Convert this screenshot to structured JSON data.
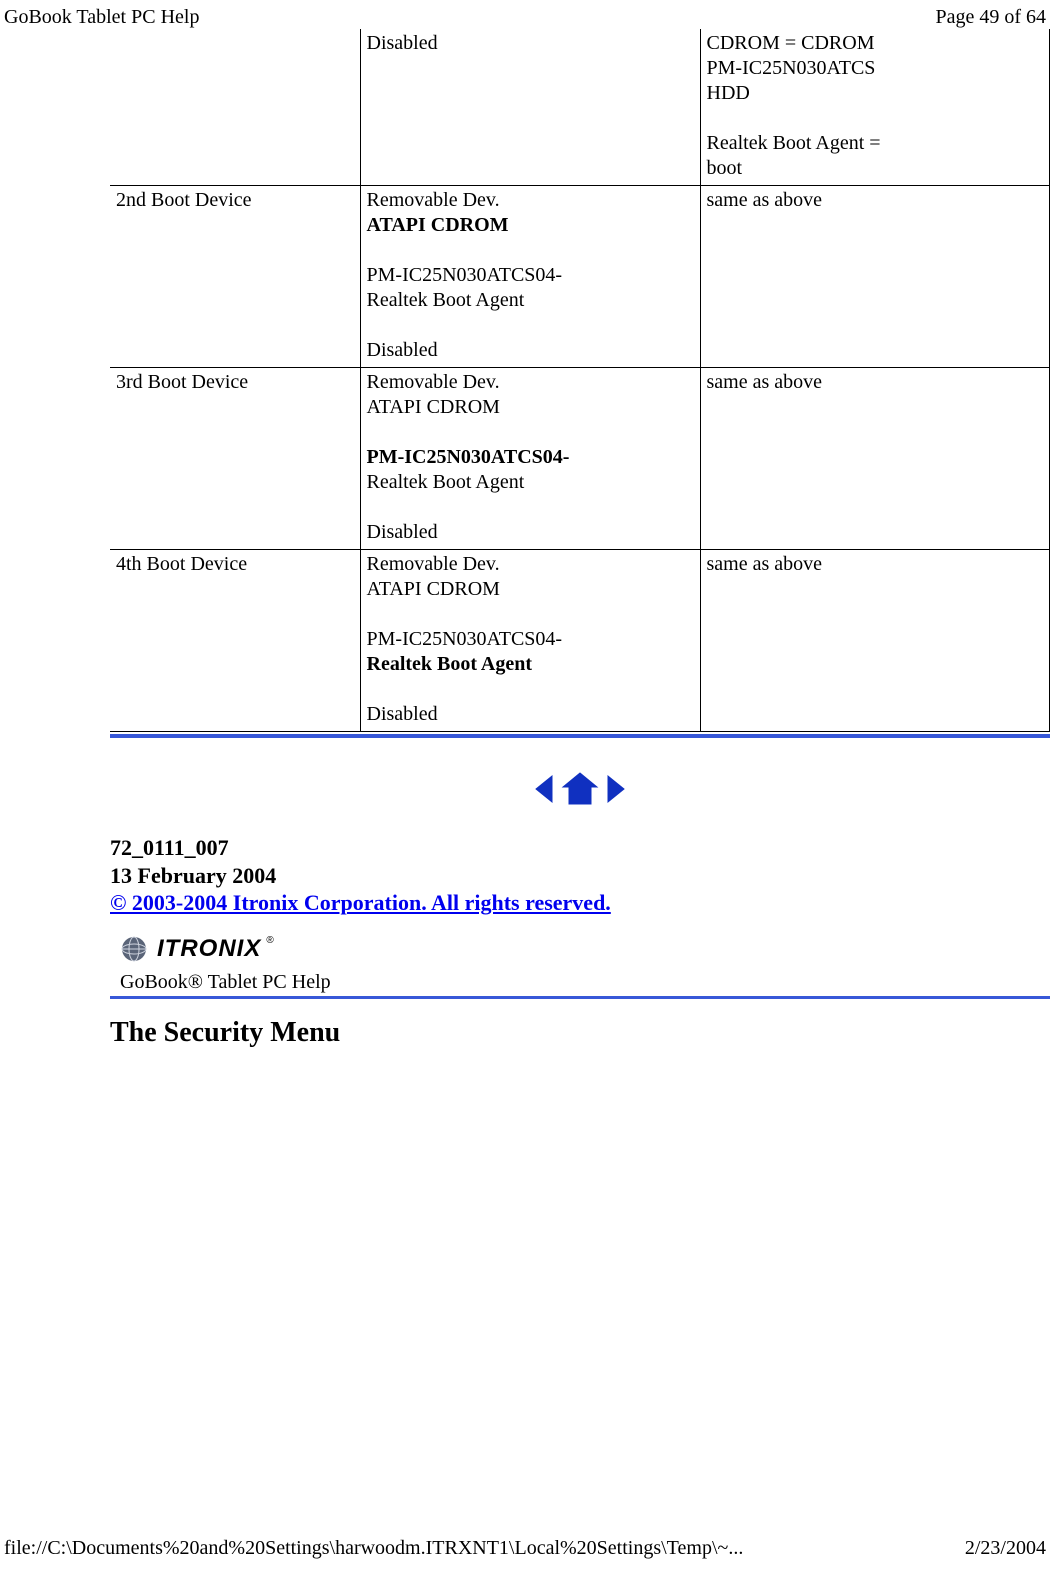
{
  "header": {
    "title": "GoBook Tablet PC Help",
    "pager": "Page 49 of 64"
  },
  "table": {
    "row0": {
      "c1_l1": "Disabled",
      "c2_l1": "CDROM = CDROM",
      "c2_l2": "PM-IC25N030ATCS",
      "c2_l3": "HDD",
      "c2_l4": "Realtek Boot Agent =",
      "c2_l5": "boot"
    },
    "row1": {
      "label": " 2nd Boot Device",
      "o1": "Removable Dev.",
      "o2": "ATAPI CDROM",
      "o3": "PM-IC25N030ATCS04-",
      "o4": "Realtek Boot Agent",
      "o5": "Disabled",
      "note": "same as above"
    },
    "row2": {
      "label": " 3rd Boot Device",
      "o1": "Removable Dev.",
      "o2": "ATAPI CDROM",
      "o3": "PM-IC25N030ATCS04-",
      "o4": "Realtek Boot Agent",
      "o5": "Disabled",
      "note": "same as above"
    },
    "row3": {
      "label": " 4th Boot Device",
      "o1": "Removable Dev.",
      "o2": "ATAPI CDROM",
      "o3": "PM-IC25N030ATCS04-",
      "o4": "Realtek Boot Agent",
      "o5": "Disabled",
      "note": "same as above"
    }
  },
  "meta": {
    "code": "72_0111_007",
    "date": "13 February 2004",
    "copyright": "© 2003-2004 Itronix Corporation.  All rights reserved. "
  },
  "brand": {
    "text": "ITRONIX"
  },
  "subhelp": "GoBook® Tablet PC Help",
  "security_heading": "The Security Menu",
  "footer": {
    "path": "file://C:\\Documents%20and%20Settings\\harwoodm.ITRXNT1\\Local%20Settings\\Temp\\~...",
    "date": "2/23/2004"
  }
}
